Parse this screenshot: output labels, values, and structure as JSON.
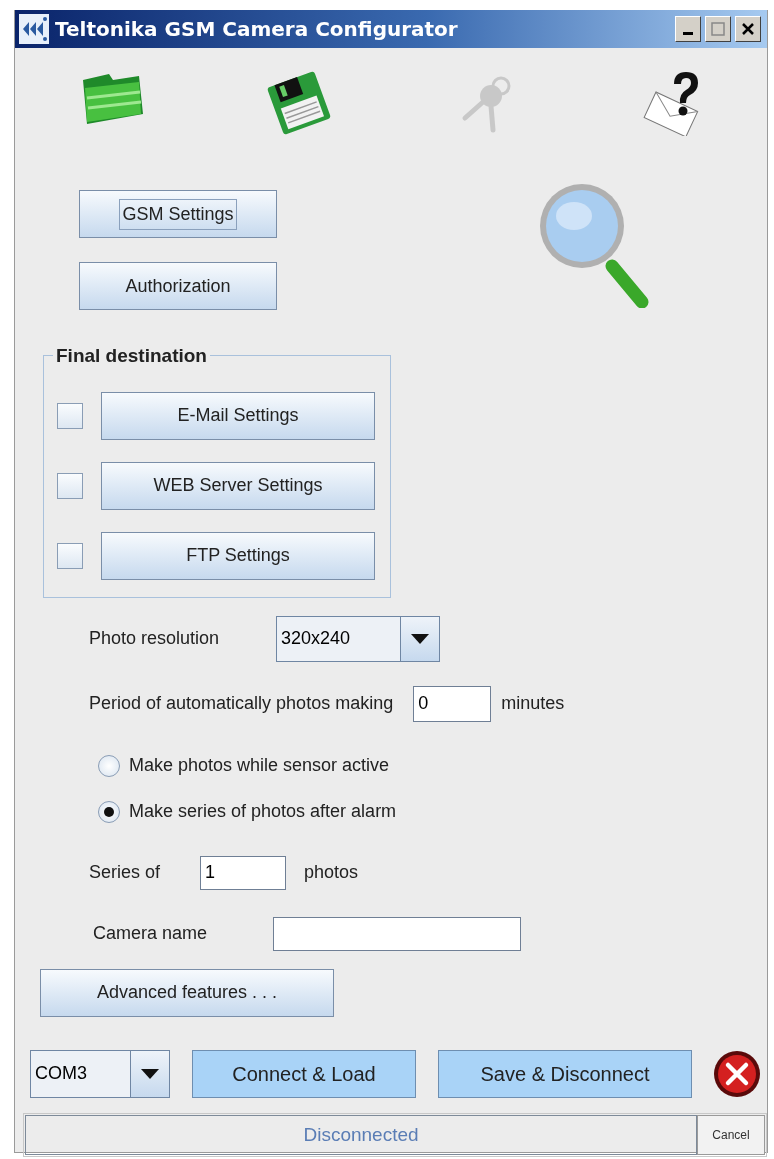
{
  "window": {
    "title": "Teltonika GSM Camera Configurator"
  },
  "toolbar": [
    {
      "disabled": false
    },
    {
      "disabled": false
    },
    {
      "disabled": true
    },
    {
      "disabled": false
    }
  ],
  "settings_buttons": [
    {
      "label": "GSM Settings",
      "focused": true
    },
    {
      "label": "Authorization",
      "focused": false
    }
  ],
  "final_destination": {
    "legend": "Final destination",
    "options": [
      {
        "label": "E-Mail Settings",
        "checked": false
      },
      {
        "label": "WEB Server Settings",
        "checked": false
      },
      {
        "label": "FTP Settings",
        "checked": false
      }
    ]
  },
  "photo_resolution": {
    "label": "Photo resolution",
    "value": "320x240"
  },
  "period": {
    "label": "Period of automatically photos making",
    "value": "0",
    "unit": "minutes"
  },
  "modes": [
    {
      "label": "Make photos while sensor active",
      "selected": false
    },
    {
      "label": "Make series of photos after alarm",
      "selected": true
    }
  ],
  "series": {
    "label": "Series of",
    "value": "1",
    "unit": "photos"
  },
  "camera_name": {
    "label": "Camera name"
  },
  "advanced_button": "Advanced features . . .",
  "port": {
    "value": "COM3"
  },
  "actions": [
    "Connect & Load",
    "Save & Disconnect"
  ],
  "status": {
    "text": "Disconnected",
    "cancel": "Cancel"
  }
}
